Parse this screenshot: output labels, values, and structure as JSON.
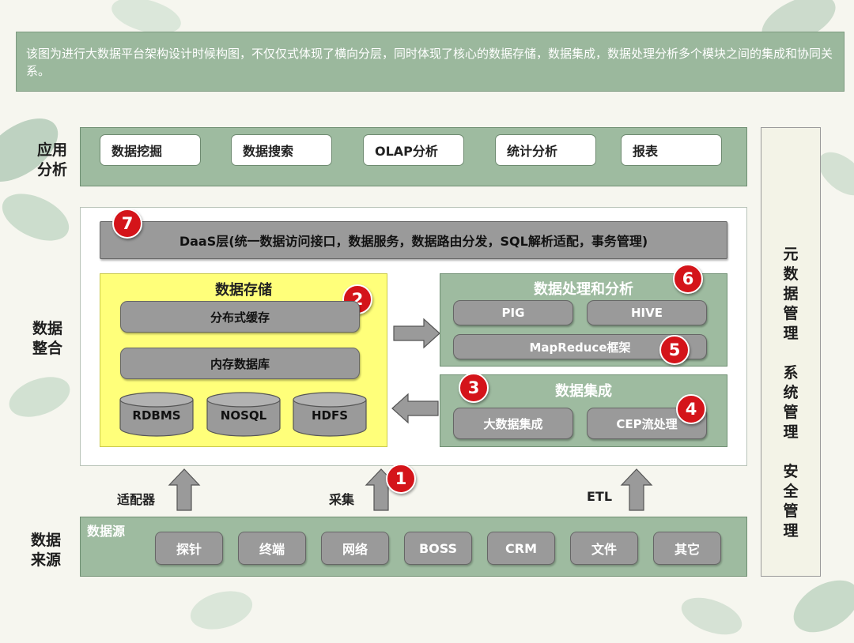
{
  "description": "该图为进行大数据平台架构设计时候构图，不仅仅式体现了横向分层，同时体现了核心的数据存储，数据集成，数据处理分析多个模块之间的集成和协同关系。",
  "layers": {
    "app": {
      "label_line1": "应用",
      "label_line2": "分析",
      "items": [
        "数据挖掘",
        "数据搜索",
        "OLAP分析",
        "统计分析",
        "报表"
      ]
    },
    "integration": {
      "label_line1": "数据",
      "label_line2": "整合"
    },
    "source": {
      "label_line1": "数据",
      "label_line2": "来源"
    }
  },
  "daas": {
    "label": "DaaS层(统一数据访问接口，数据服务，数据路由分发，SQL解析适配，事务管理)",
    "badge": "7"
  },
  "storage": {
    "title": "数据存储",
    "badge": "2",
    "cache": "分布式缓存",
    "memdb": "内存数据库",
    "databases": [
      "RDBMS",
      "NOSQL",
      "HDFS"
    ]
  },
  "processing": {
    "title": "数据处理和分析",
    "badge": "6",
    "pig": "PIG",
    "hive": "HIVE",
    "mapreduce": "MapReduce框架",
    "mapreduce_badge": "5"
  },
  "integration_box": {
    "title": "数据集成",
    "badge": "3",
    "bigdata": "大数据集成",
    "cep": "CEP流处理",
    "cep_badge": "4"
  },
  "arrows": {
    "adapter": "适配器",
    "collect": "采集",
    "collect_badge": "1",
    "etl": "ETL"
  },
  "sources": {
    "title": "数据源",
    "items": [
      "探针",
      "终端",
      "网络",
      "BOSS",
      "CRM",
      "文件",
      "其它"
    ]
  },
  "meta": {
    "chars": [
      "元",
      "数",
      "据",
      "管",
      "理",
      "",
      "系",
      "统",
      "管",
      "理",
      "",
      "安",
      "全",
      "管",
      "理"
    ]
  }
}
